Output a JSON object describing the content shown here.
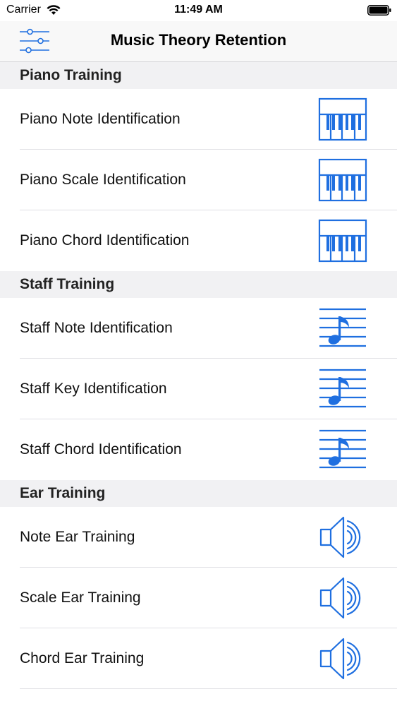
{
  "status_bar": {
    "carrier": "Carrier",
    "time": "11:49 AM"
  },
  "nav": {
    "title": "Music Theory Retention",
    "settings_icon": "sliders-icon"
  },
  "colors": {
    "accent": "#1f6fe0",
    "section_bg": "#f1f1f3",
    "separator": "#e0e0e4"
  },
  "sections": [
    {
      "title": "Piano Training",
      "icon": "piano-keyboard-icon",
      "items": [
        {
          "label": "Piano Note Identification"
        },
        {
          "label": "Piano Scale Identification"
        },
        {
          "label": "Piano Chord Identification"
        }
      ]
    },
    {
      "title": "Staff Training",
      "icon": "music-staff-icon",
      "items": [
        {
          "label": "Staff Note Identification"
        },
        {
          "label": "Staff Key Identification"
        },
        {
          "label": "Staff Chord Identification"
        }
      ]
    },
    {
      "title": "Ear Training",
      "icon": "speaker-icon",
      "items": [
        {
          "label": "Note Ear Training"
        },
        {
          "label": "Scale Ear Training"
        },
        {
          "label": "Chord Ear Training"
        }
      ]
    }
  ]
}
